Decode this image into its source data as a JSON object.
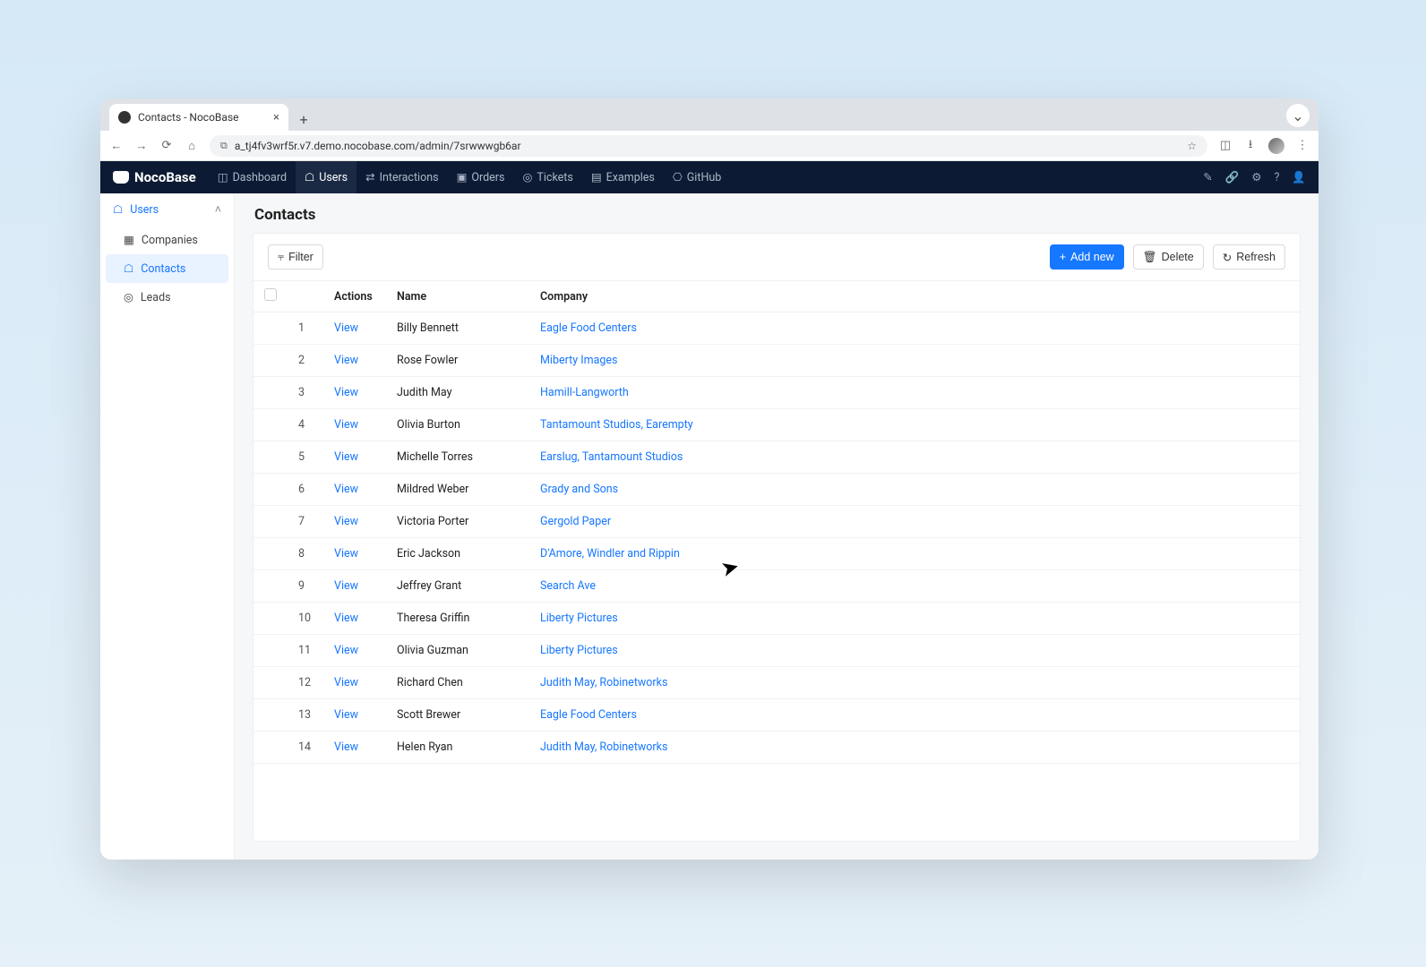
{
  "browser": {
    "tab_title": "Contacts - NocoBase",
    "url": "a_tj4fv3wrf5r.v7.demo.nocobase.com/admin/7srwwwgb6ar"
  },
  "app_nav": {
    "brand": "NocoBase",
    "items": [
      "Dashboard",
      "Users",
      "Interactions",
      "Orders",
      "Tickets",
      "Examples",
      "GitHub"
    ],
    "active_index": 1
  },
  "sidebar": {
    "group": "Users",
    "items": [
      "Companies",
      "Contacts",
      "Leads"
    ],
    "active_index": 1
  },
  "page": {
    "title": "Contacts"
  },
  "toolbar": {
    "filter": "Filter",
    "add_new": "Add new",
    "delete": "Delete",
    "refresh": "Refresh"
  },
  "table": {
    "headers": {
      "actions": "Actions",
      "name": "Name",
      "company": "Company"
    },
    "view_label": "View",
    "rows": [
      {
        "idx": "1",
        "name": "Billy Bennett",
        "company": "Eagle Food Centers"
      },
      {
        "idx": "2",
        "name": "Rose Fowler",
        "company": "Miberty Images"
      },
      {
        "idx": "3",
        "name": "Judith May",
        "company": "Hamill-Langworth"
      },
      {
        "idx": "4",
        "name": "Olivia Burton",
        "company": "Tantamount Studios, Earempty"
      },
      {
        "idx": "5",
        "name": "Michelle Torres",
        "company": "Earslug, Tantamount Studios"
      },
      {
        "idx": "6",
        "name": "Mildred Weber",
        "company": "Grady and Sons"
      },
      {
        "idx": "7",
        "name": "Victoria Porter",
        "company": "Gergold Paper"
      },
      {
        "idx": "8",
        "name": "Eric Jackson",
        "company": "D'Amore, Windler and Rippin"
      },
      {
        "idx": "9",
        "name": "Jeffrey Grant",
        "company": "Search Ave"
      },
      {
        "idx": "10",
        "name": "Theresa Griffin",
        "company": "Liberty Pictures"
      },
      {
        "idx": "11",
        "name": "Olivia Guzman",
        "company": "Liberty Pictures"
      },
      {
        "idx": "12",
        "name": "Richard Chen",
        "company": "Judith May, Robinetworks"
      },
      {
        "idx": "13",
        "name": "Scott Brewer",
        "company": "Eagle Food Centers"
      },
      {
        "idx": "14",
        "name": "Helen Ryan",
        "company": "Judith May, Robinetworks"
      }
    ]
  }
}
